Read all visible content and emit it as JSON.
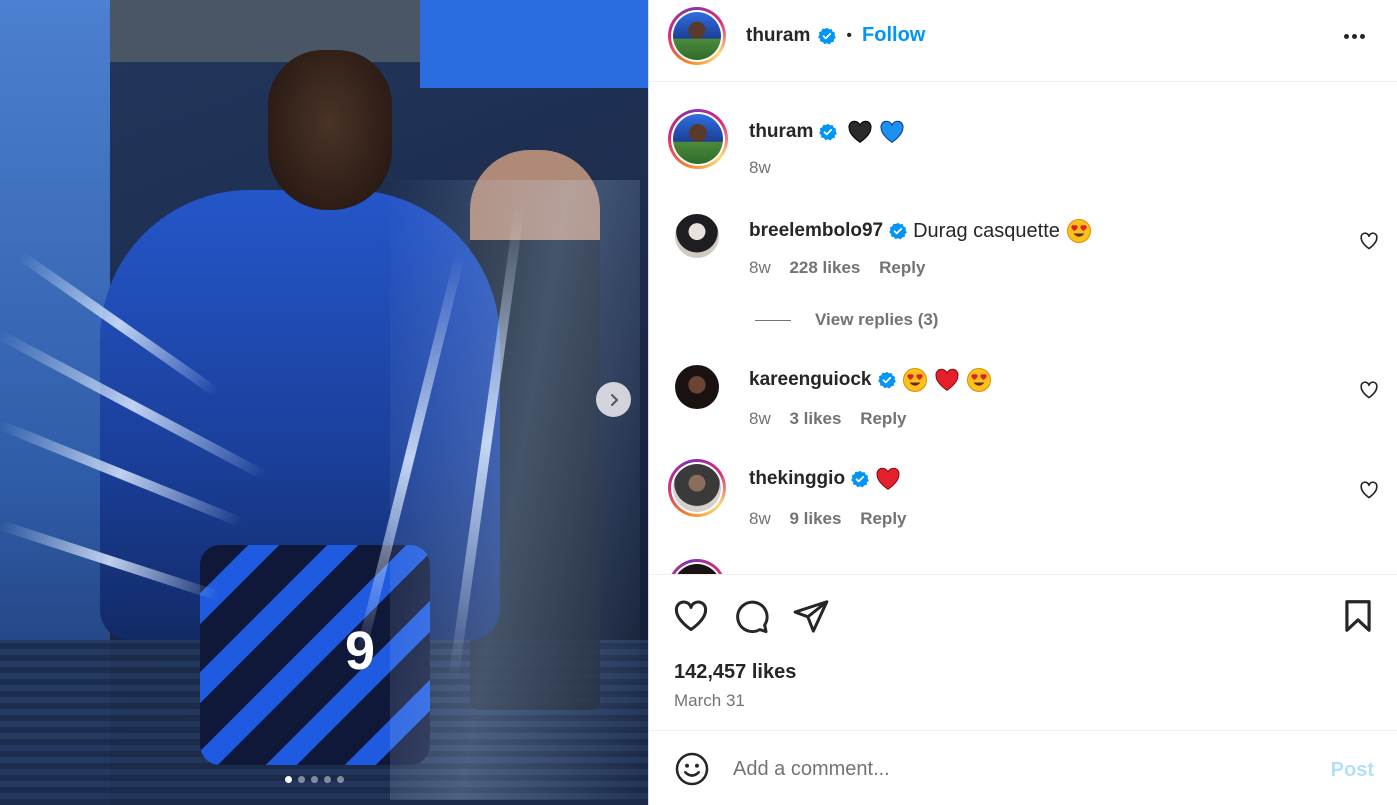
{
  "header": {
    "username": "thuram",
    "separator": "•",
    "follow_label": "Follow"
  },
  "caption": {
    "username": "thuram",
    "emojis": [
      "black-heart",
      "blue-heart"
    ],
    "time": "8w"
  },
  "comments": [
    {
      "username": "breelembolo97",
      "text": "Durag casquette",
      "emojis": [
        "heart-eyes"
      ],
      "time": "8w",
      "likes": "228 likes",
      "reply_label": "Reply",
      "view_replies": "View replies (3)"
    },
    {
      "username": "kareenguiock",
      "text": "",
      "emojis": [
        "heart-eyes",
        "red-heart",
        "heart-eyes"
      ],
      "time": "8w",
      "likes": "3 likes",
      "reply_label": "Reply"
    },
    {
      "username": "thekinggio",
      "text": "",
      "emojis": [
        "red-heart"
      ],
      "time": "8w",
      "likes": "9 likes",
      "reply_label": "Reply"
    }
  ],
  "post": {
    "likes": "142,457 likes",
    "date": "March 31"
  },
  "add_comment": {
    "placeholder": "Add a comment...",
    "post_label": "Post"
  },
  "media": {
    "jersey_number": "9",
    "carousel_count": 5,
    "carousel_active": 1
  },
  "colors": {
    "accent": "#0095f6",
    "verified": "#0095f6",
    "muted_text": "#737373",
    "post_disabled": "#b2dffc"
  }
}
